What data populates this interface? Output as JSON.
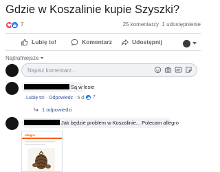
{
  "post": {
    "title": "Gdzie w Koszalinie kupie Szyszki?",
    "reactions": {
      "icons": [
        "love",
        "like"
      ],
      "count": "7"
    },
    "stats": {
      "comments": "25 komentarzy",
      "shares": "1 udostępnienie"
    }
  },
  "actions": {
    "like": "Lubię to!",
    "comment": "Komentarz",
    "share": "Udostępnij"
  },
  "sort": {
    "label": "Najtrafniejsze"
  },
  "composer": {
    "placeholder": "Napisz komentarz...",
    "icons": [
      "emoji-icon",
      "camera-icon",
      "gif-icon",
      "sticker-icon"
    ]
  },
  "comments": [
    {
      "text": "Są w lesie",
      "like_action": "Lubię to!",
      "separator": " · ",
      "reply_action": "Odpowiedz",
      "time": "5 d",
      "like_count": "7",
      "replies": "1 odpowiedzi"
    },
    {
      "text": "Jak będzie problem w Koszalinie... Polecam allegro",
      "attachment": {
        "logo": "allegro",
        "accent": "#ff5a00"
      }
    }
  ],
  "colors": {
    "text": "#1c1e21",
    "secondary": "#606770",
    "link": "#385898",
    "like_blue": "#1877f2",
    "love_red": "#f33e58",
    "bubble": "#f0f2f5",
    "divider": "#dadde1"
  }
}
